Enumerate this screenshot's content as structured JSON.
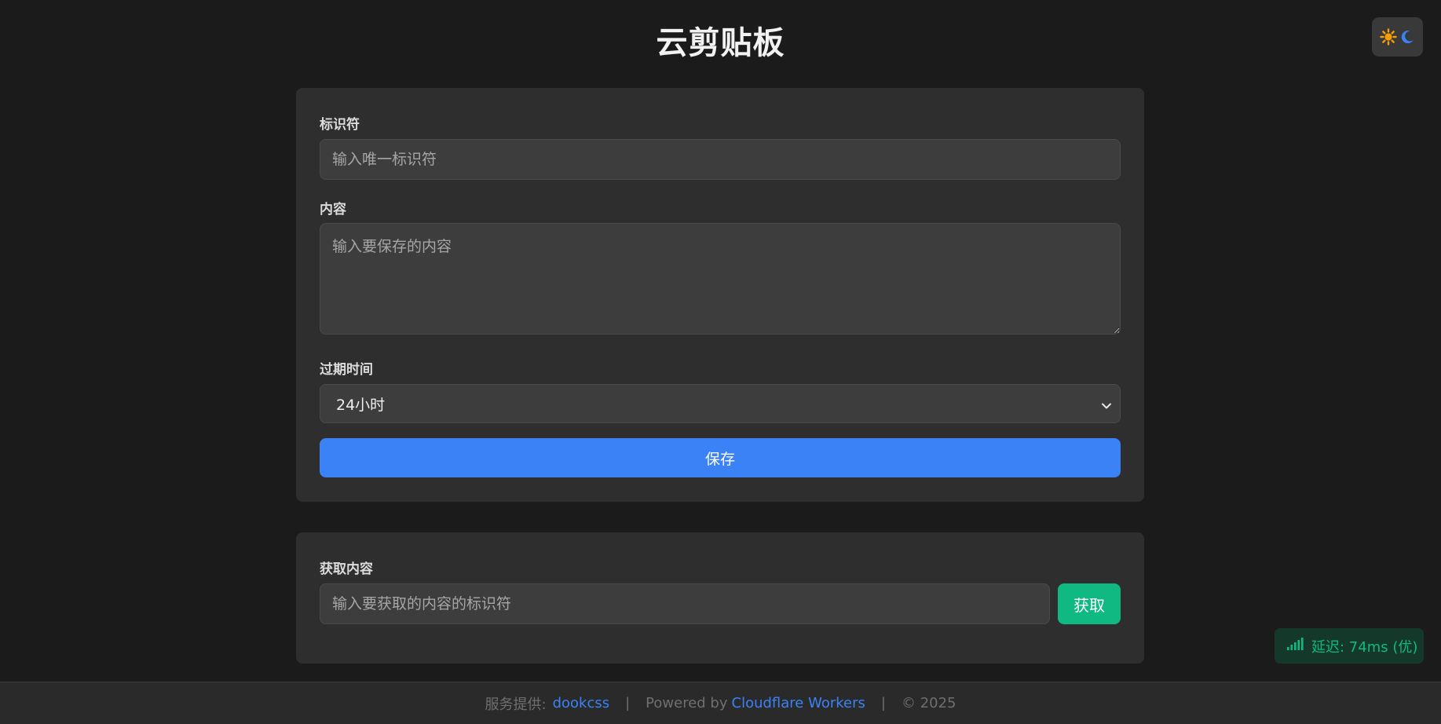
{
  "app": {
    "title": "云剪贴板"
  },
  "theme_toggle": {
    "icons": [
      "sun-icon",
      "moon-icon"
    ],
    "sun_color": "#f59e0b",
    "moon_color": "#3b82f6"
  },
  "save_form": {
    "identifier_label": "标识符",
    "identifier_placeholder": "输入唯一标识符",
    "identifier_value": "",
    "content_label": "内容",
    "content_placeholder": "输入要保存的内容",
    "content_value": "",
    "expiry_label": "过期时间",
    "expiry_selected": "24小时",
    "save_label": "保存"
  },
  "fetch_form": {
    "label": "获取内容",
    "placeholder": "输入要获取的内容的标识符",
    "value": "",
    "button_label": "获取"
  },
  "latency": {
    "text": "延迟: 74ms (优)",
    "color": "#10b981"
  },
  "footer": {
    "provider_prefix": "服务提供:",
    "provider_link": "dookcss",
    "separator": "|",
    "powered_prefix": "Powered by",
    "powered_link": "Cloudflare Workers",
    "copyright": "© 2025"
  },
  "colors": {
    "background": "#1b1b1b",
    "card": "#2e2e2e",
    "primary": "#3b82f6",
    "success": "#10b981"
  }
}
